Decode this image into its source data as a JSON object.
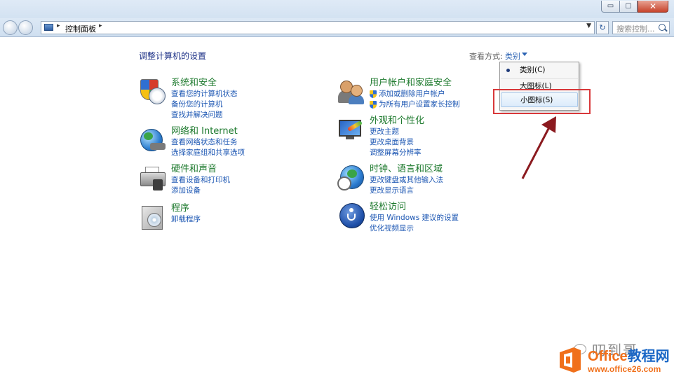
{
  "window": {
    "minimize": "▭",
    "maximize": "▢",
    "close": "✕"
  },
  "navbar": {
    "breadcrumb": "控制面板",
    "search_placeholder": "搜索控制...",
    "refresh": "↻"
  },
  "content": {
    "title": "调整计算机的设置",
    "view_by_label": "查看方式:",
    "view_by_value": "类别"
  },
  "categories": [
    {
      "title": "系统和安全",
      "links": [
        "查看您的计算机状态",
        "备份您的计算机",
        "查找并解决问题"
      ]
    },
    {
      "title": "网络和 Internet",
      "links": [
        "查看网络状态和任务",
        "选择家庭组和共享选项"
      ]
    },
    {
      "title": "硬件和声音",
      "links": [
        "查看设备和打印机",
        "添加设备"
      ]
    },
    {
      "title": "程序",
      "links": [
        "卸载程序"
      ]
    },
    {
      "title": "用户帐户和家庭安全",
      "links": [
        "添加或删除用户帐户",
        "为所有用户设置家长控制"
      ]
    },
    {
      "title": "外观和个性化",
      "links": [
        "更改主题",
        "更改桌面背景",
        "调整屏幕分辨率"
      ]
    },
    {
      "title": "时钟、语言和区域",
      "links": [
        "更改键盘或其他输入法",
        "更改显示语言"
      ]
    },
    {
      "title": "轻松访问",
      "links": [
        "使用 Windows 建议的设置",
        "优化视频显示"
      ]
    }
  ],
  "view_menu": {
    "items": [
      "类别(C)",
      "大图标(L)",
      "小图标(S)"
    ],
    "selected_index": 0,
    "hovered_index": 2
  },
  "annotation": {
    "highlight_color": "#d8383a",
    "arrow_color": "#8b1a1f"
  },
  "watermark": {
    "author": "叨到哥",
    "site_name_a": "Office",
    "site_name_b": "教程网",
    "url": "www.office26.com",
    "colors": {
      "orange": "#f0701b",
      "blue": "#1a67c6"
    }
  }
}
